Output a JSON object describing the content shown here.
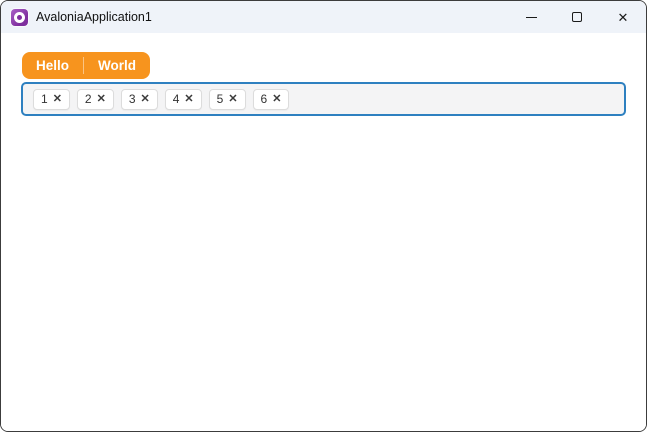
{
  "titlebar": {
    "title": "AvaloniaApplication1"
  },
  "icons": {
    "app_logo": "avalonia-logo",
    "minimize": "minimize-icon",
    "maximize": "maximize-icon",
    "close": "close-icon",
    "close_glyph": "✕"
  },
  "colors": {
    "titlebar_bg": "#eff3f9",
    "window_border": "#3c3c3c",
    "accent_orange": "#f7941e",
    "chipbox_border": "#2e80c0",
    "chipbox_bg": "#f4f4f5",
    "chip_bg": "#ffffff",
    "chip_border": "#dcdcdc",
    "text_dark": "#333333",
    "logo_purple": "#7f2f9e"
  },
  "tabstrip": {
    "tabs": [
      {
        "label": "Hello"
      },
      {
        "label": "World"
      }
    ]
  },
  "chipbox": {
    "remove_glyph": "✕",
    "items": [
      {
        "label": "1"
      },
      {
        "label": "2"
      },
      {
        "label": "3"
      },
      {
        "label": "4"
      },
      {
        "label": "5"
      },
      {
        "label": "6"
      }
    ]
  }
}
